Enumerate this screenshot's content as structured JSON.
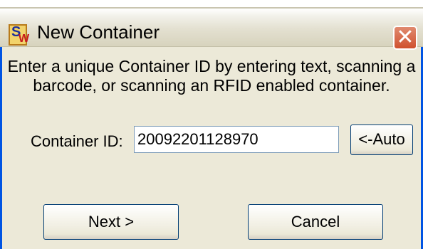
{
  "window": {
    "title": "New Container",
    "close_glyph": "✕",
    "app_icon": {
      "letter_top": "S",
      "letter_bottom": "W"
    }
  },
  "prompt": "Enter a unique Container ID by entering text, scanning a barcode, or scanning an RFID enabled container.",
  "container_id": {
    "label": "Container ID:",
    "value": "20092201128970",
    "auto_label": "<-Auto"
  },
  "buttons": {
    "next": "Next >",
    "cancel": "Cancel"
  },
  "colors": {
    "frame": "#0054e3",
    "dialog_bg": "#ece9d8",
    "close_red": "#d0512f"
  }
}
